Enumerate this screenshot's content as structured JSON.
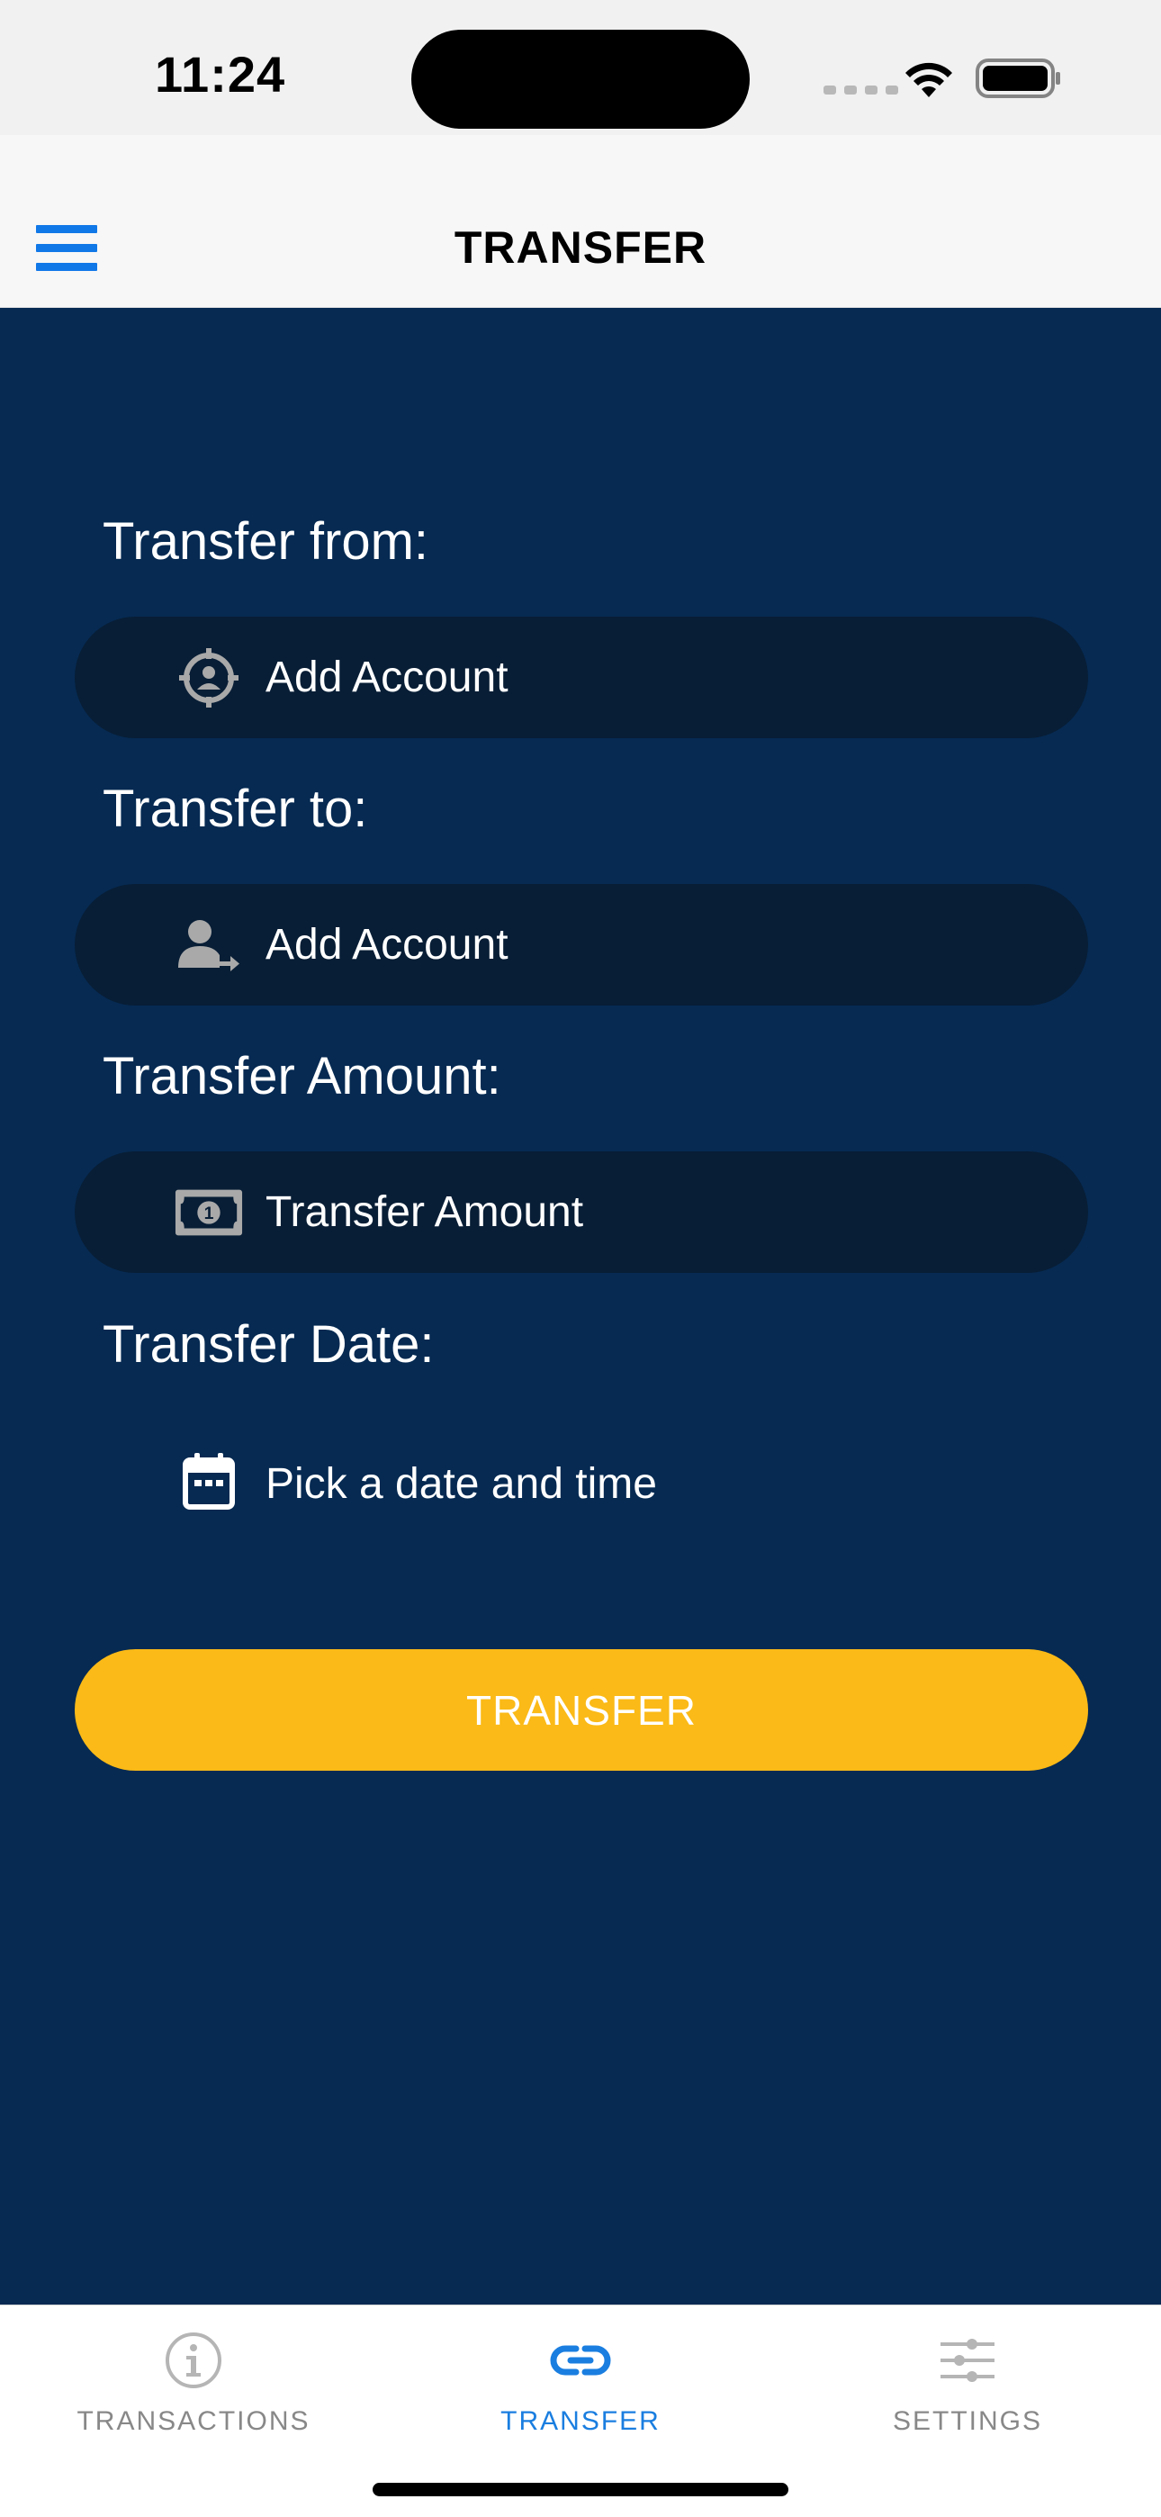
{
  "status_bar": {
    "time": "11:24"
  },
  "nav": {
    "title": "TRANSFER",
    "menu_icon": "hamburger-menu-icon",
    "accent_color": "#1178e8"
  },
  "form": {
    "from_label": "Transfer from:",
    "from_placeholder": "Add Account",
    "from_icon": "account-target-icon",
    "to_label": "Transfer to:",
    "to_placeholder": "Add Account",
    "to_icon": "person-transfer-icon",
    "amount_label": "Transfer Amount:",
    "amount_placeholder": "Transfer Amount",
    "amount_icon": "banknote-icon",
    "date_label": "Transfer Date:",
    "date_placeholder": "Pick a date and time",
    "date_icon": "calendar-icon",
    "submit_label": "TRANSFER",
    "submit_color": "#fbba17",
    "background_color": "#062a52",
    "field_color": "#081e36"
  },
  "tab_bar": {
    "tabs": [
      {
        "label": "TRANSACTIONS",
        "icon": "info-circle-icon",
        "active": false
      },
      {
        "label": "TRANSFER",
        "icon": "link-icon",
        "active": true
      },
      {
        "label": "SETTINGS",
        "icon": "sliders-icon",
        "active": false
      }
    ],
    "active_color": "#1a7ee0",
    "inactive_color": "#888888"
  }
}
